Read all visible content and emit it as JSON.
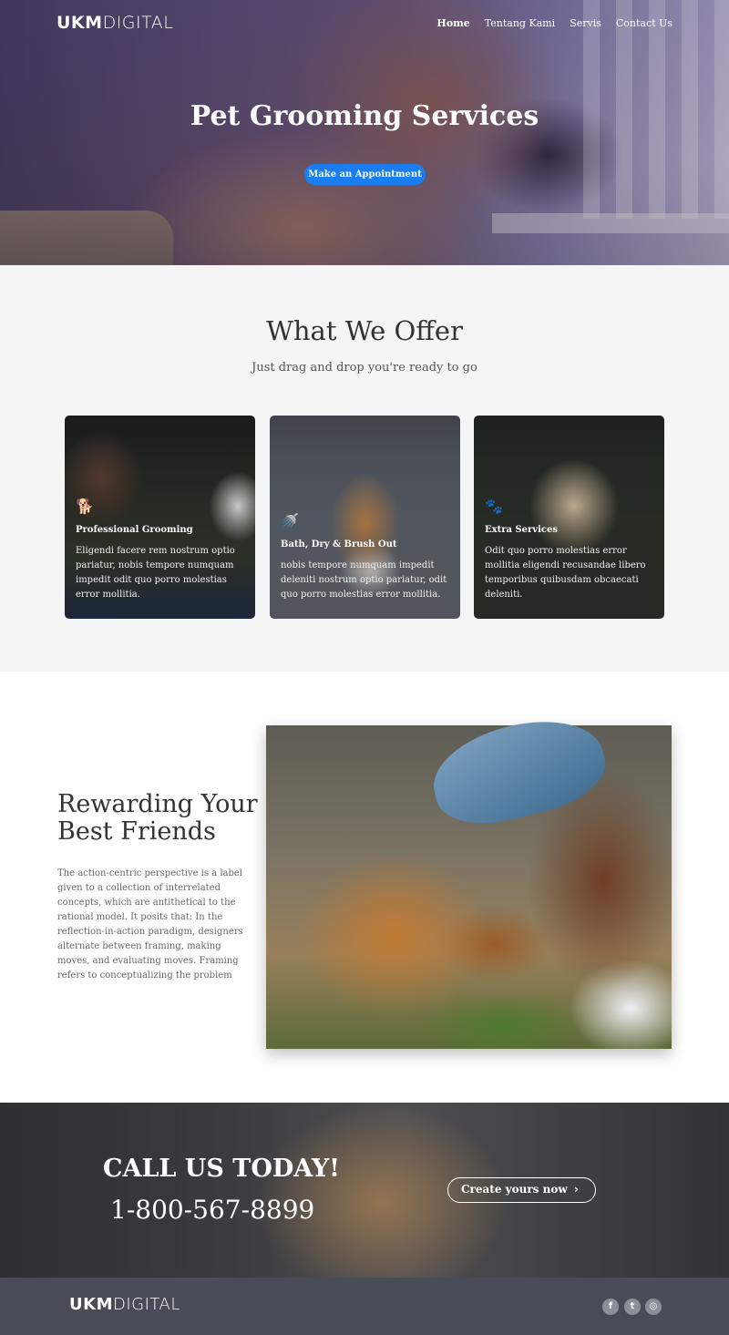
{
  "brand": {
    "logo_bold": "UKM",
    "logo_light": "DIGITAL"
  },
  "nav": {
    "items": [
      {
        "label": "Home"
      },
      {
        "label": "Tentang Kami"
      },
      {
        "label": "Servis"
      },
      {
        "label": "Contact Us"
      }
    ]
  },
  "hero": {
    "title": "Pet Grooming Services",
    "button_label": "Make an Appointment"
  },
  "offer": {
    "title": "What We Offer",
    "subtitle": "Just drag and drop you're ready to go",
    "cards": [
      {
        "icon": "dog-icon",
        "glyph": "🐕",
        "title": "Professional Grooming",
        "text": "Eligendi facere rem nostrum optio pariatur, nobis tempore numquam impedit odit quo porro molestias error mollitia."
      },
      {
        "icon": "shower-icon",
        "glyph": "🚿",
        "title": "Bath, Dry & Brush Out",
        "text": "nobis tempore numquam impedit deleniti nostrum optio pariatur, odit quo porro molestias error mollitia."
      },
      {
        "icon": "paw-icon",
        "glyph": "🐾",
        "title": "Extra Services",
        "text": "Odit quo porro molestias error mollitia eligendi recusandae libero temporibus quibusdam obcaecati deleniti."
      }
    ]
  },
  "reward": {
    "title_line1": "Rewarding Your",
    "title_line2": "Best Friends",
    "text": "The action-centric perspective is a label given to a collection of interrelated concepts, which are antithetical to the rational model. It posits that: In the reflection-in-action paradigm, designers alternate between framing, making moves, and evaluating moves. Framing refers to conceptualizing the problem"
  },
  "call": {
    "title": "CALL US TODAY!",
    "phone": "1-800-567-8899",
    "button_label": "Create yours now",
    "button_icon": "chevron-right-icon"
  },
  "footer": {
    "social": [
      {
        "name": "facebook-icon",
        "glyph": "f"
      },
      {
        "name": "twitter-icon",
        "glyph": "t"
      },
      {
        "name": "instagram-icon",
        "glyph": "◎"
      }
    ]
  },
  "colors": {
    "accent": "#1a7ef2",
    "footer_bg": "#474c56",
    "offer_bg": "#f5f5f5"
  }
}
